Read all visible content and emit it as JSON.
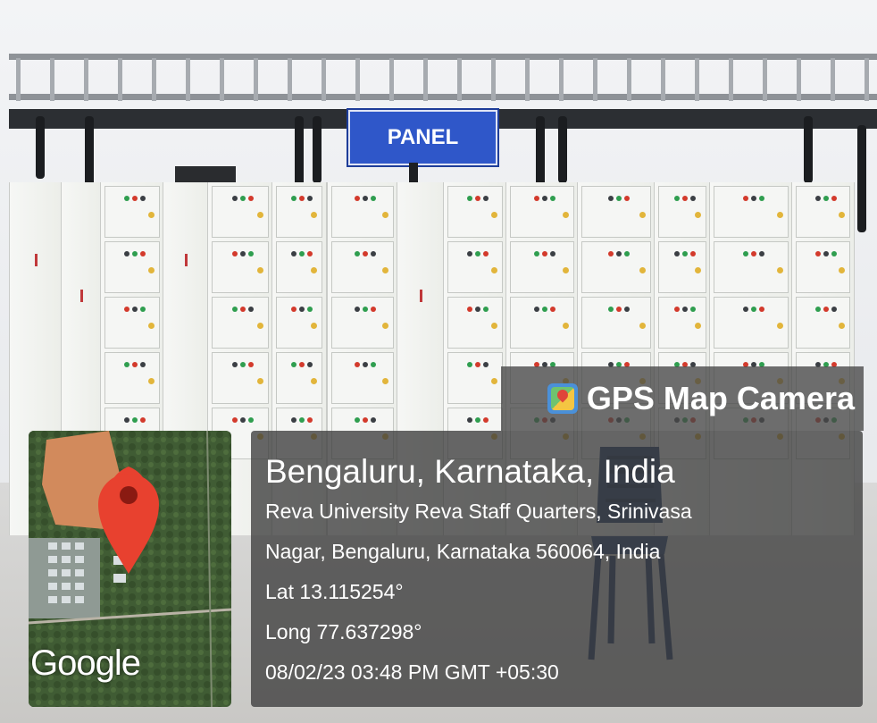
{
  "sign": {
    "text": "PANEL"
  },
  "overlay": {
    "app_title": "GPS Map Camera",
    "app_icon": "gps-map-camera-app-icon",
    "city": "Bengaluru, Karnataka, India",
    "address_line1": "Reva University Reva Staff Quarters, Srinivasa",
    "address_line2": "Nagar, Bengaluru, Karnataka 560064, India",
    "latitude": "Lat 13.115254°",
    "longitude": "Long 77.637298°",
    "datetime": "08/02/23 03:48 PM GMT +05:30"
  },
  "map": {
    "logo_text": "Google",
    "marker_icon": "map-marker-icon",
    "marker_color": "#e8412f"
  }
}
